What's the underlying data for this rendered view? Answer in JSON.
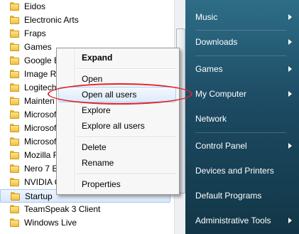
{
  "programs": [
    {
      "label": "Eidos"
    },
    {
      "label": "Electronic Arts"
    },
    {
      "label": "Fraps"
    },
    {
      "label": "Games"
    },
    {
      "label": "Google E"
    },
    {
      "label": "Image Re"
    },
    {
      "label": "Logitech"
    },
    {
      "label": "Mainten"
    },
    {
      "label": "Microsof"
    },
    {
      "label": "Microsof"
    },
    {
      "label": "Microsof"
    },
    {
      "label": "Mozilla F"
    },
    {
      "label": "Nero 7 E"
    },
    {
      "label": "NVIDIA C"
    },
    {
      "label": "Startup"
    },
    {
      "label": "TeamSpeak 3 Client"
    },
    {
      "label": "Windows Live"
    }
  ],
  "context_menu": {
    "expand": "Expand",
    "open": "Open",
    "open_all_users": "Open all users",
    "explore": "Explore",
    "explore_all_users": "Explore all users",
    "delete": "Delete",
    "rename": "Rename",
    "properties": "Properties"
  },
  "right_pane": {
    "music": "Music",
    "downloads": "Downloads",
    "games": "Games",
    "my_computer": "My Computer",
    "network": "Network",
    "control_panel": "Control Panel",
    "devices_and_printers": "Devices and Printers",
    "default_programs": "Default Programs",
    "administrative_tools": "Administrative Tools"
  },
  "colors": {
    "highlight_ellipse": "#e2232a",
    "right_pane_top": "#2e6d87",
    "right_pane_bottom": "#123647"
  }
}
